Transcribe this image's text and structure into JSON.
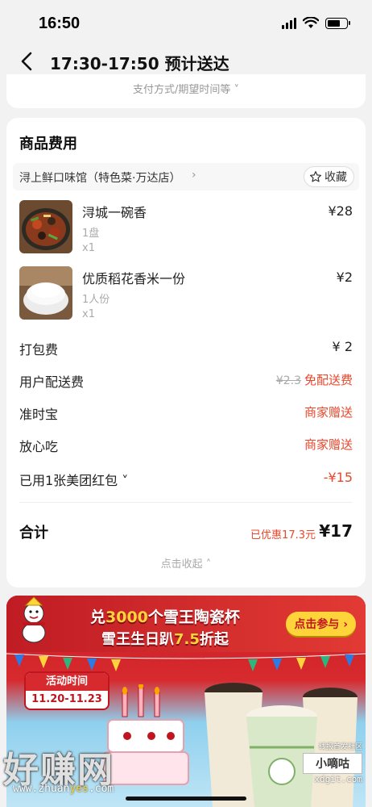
{
  "status_bar": {
    "time": "16:50"
  },
  "nav": {
    "title": "17:30-17:50 预计送达"
  },
  "top_card": {
    "more_text": "支付方式/期望时间等 ˅"
  },
  "fee_card": {
    "title": "商品费用",
    "shop_name": "浔上鲜口味馆（特色菜·万达店）",
    "shop_arrow": "›",
    "favorite_label": "收藏",
    "items": [
      {
        "name": "浔城一碗香",
        "spec": "1盘",
        "qty": "x1",
        "price": "¥28"
      },
      {
        "name": "优质稻花香米一份",
        "spec": "1人份",
        "qty": "x1",
        "price": "¥2"
      }
    ],
    "packing_fee": {
      "label": "打包费",
      "value": "¥ 2"
    },
    "delivery_fee": {
      "label": "用户配送费",
      "original": "¥2.3",
      "value": "免配送费"
    },
    "on_time": {
      "label": "准时宝",
      "value": "商家赠送"
    },
    "safe_eat": {
      "label": "放心吃",
      "value": "商家赠送"
    },
    "red_packet": {
      "label": "已用1张美团红包 ˅",
      "value": "-¥15"
    },
    "total": {
      "label": "合计",
      "saved": "已优惠17.3元",
      "value": "¥17"
    },
    "collapse_text": "点击收起 ˄"
  },
  "banner": {
    "line1_pre": "兑",
    "line1_num": "3000",
    "line1_post": "个雪王陶瓷杯",
    "line2_pre": "雪王生日趴",
    "line2_num": "7.5",
    "line2_post": "折起",
    "cta": "点击参与 ›",
    "time_title": "活动时间",
    "time_range": "11.20-11.23"
  },
  "watermark": {
    "big": "好赚网",
    "url_pre": "www.zhuan",
    "url_hl": "yes",
    "url_post": ".com",
    "corner_top": "线报首发社区",
    "corner_mid": "小嘀咕",
    "corner_bottom": "xdgit.com"
  },
  "colors": {
    "accent": "#e8472b",
    "background": "#f2f2f2",
    "banner_red": "#d72a2e"
  }
}
